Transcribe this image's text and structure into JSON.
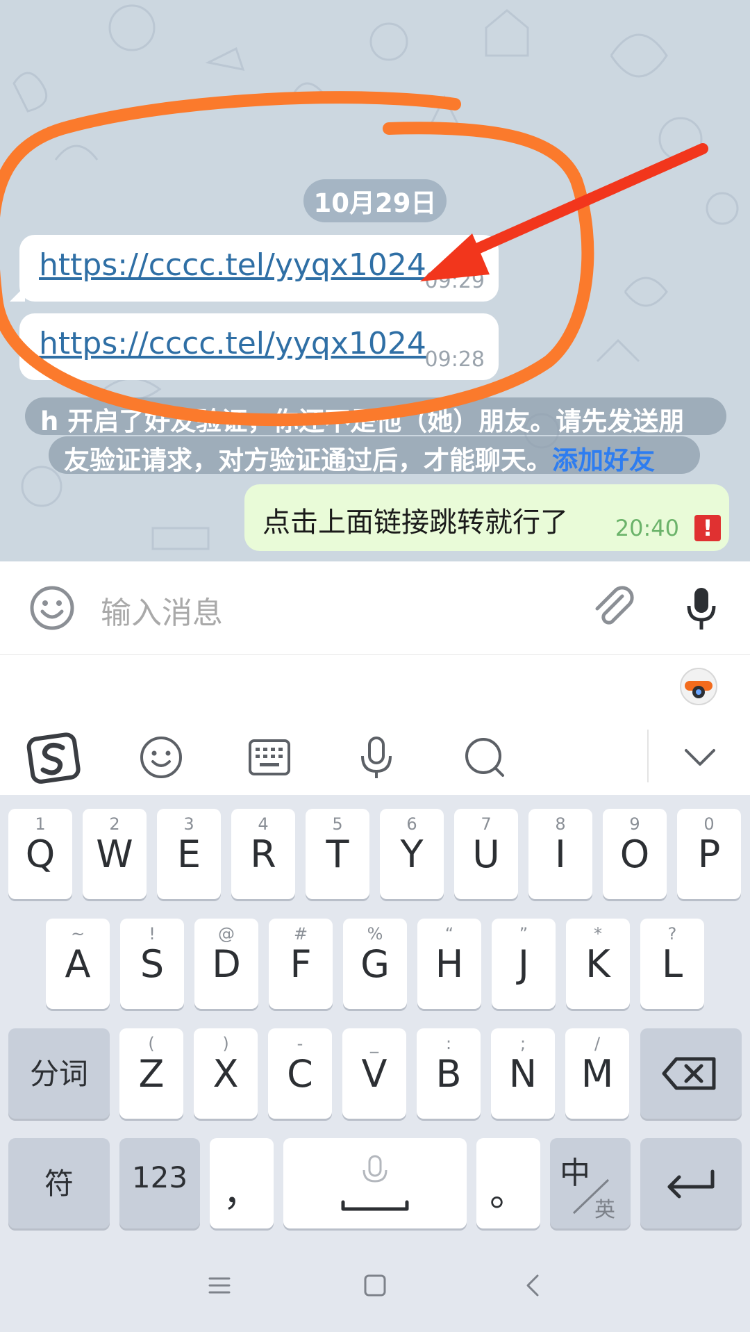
{
  "chat": {
    "date_label": "10月29日",
    "messages": [
      {
        "link": "https://cccc.tel/yyqx1024",
        "time": "09:29"
      },
      {
        "link": "https://cccc.tel/yyqx1024",
        "time": "09:28"
      }
    ],
    "system_notice": {
      "line1": "h 开启了好友验证，你还不是他（她）朋友。请先发送朋",
      "line2": "友验证请求，对方验证通过后，才能聊天。",
      "action_label": "添加好友"
    },
    "outgoing": {
      "text": "点击上面链接跳转就行了",
      "time": "20:40",
      "error_mark": "!"
    },
    "colors": {
      "annotation_circle": "#fb7a2c",
      "annotation_arrow": "#f2361c",
      "link": "#2f6fa5",
      "action": "#2e7df0"
    }
  },
  "input_bar": {
    "placeholder": "输入消息",
    "icons": [
      "smile-icon",
      "paperclip-icon",
      "microphone-icon"
    ]
  },
  "ime_toolbar": {
    "icons": [
      "sogou-logo-icon",
      "emoji-icon",
      "keyboard-icon",
      "voice-icon",
      "search-icon",
      "chevron-down-icon"
    ]
  },
  "keyboard": {
    "row1": [
      {
        "k": "Q",
        "s": "1"
      },
      {
        "k": "W",
        "s": "2"
      },
      {
        "k": "E",
        "s": "3"
      },
      {
        "k": "R",
        "s": "4"
      },
      {
        "k": "T",
        "s": "5"
      },
      {
        "k": "Y",
        "s": "6"
      },
      {
        "k": "U",
        "s": "7"
      },
      {
        "k": "I",
        "s": "8"
      },
      {
        "k": "O",
        "s": "9"
      },
      {
        "k": "P",
        "s": "0"
      }
    ],
    "row2": [
      {
        "k": "A",
        "s": "~"
      },
      {
        "k": "S",
        "s": "!"
      },
      {
        "k": "D",
        "s": "@"
      },
      {
        "k": "F",
        "s": "#"
      },
      {
        "k": "G",
        "s": "%"
      },
      {
        "k": "H",
        "s": "“"
      },
      {
        "k": "J",
        "s": "”"
      },
      {
        "k": "K",
        "s": "*"
      },
      {
        "k": "L",
        "s": "?"
      }
    ],
    "row3": [
      {
        "k": "Z",
        "s": "("
      },
      {
        "k": "X",
        "s": ")"
      },
      {
        "k": "C",
        "s": "-"
      },
      {
        "k": "V",
        "s": "_"
      },
      {
        "k": "B",
        "s": ":"
      },
      {
        "k": "N",
        "s": ";"
      },
      {
        "k": "M",
        "s": "/"
      }
    ],
    "segment_key": "分词",
    "symbol_key": "符",
    "number_key": "123",
    "comma_key": "，",
    "period_key": "。",
    "lang_key_main": "中",
    "lang_key_sub": "英"
  },
  "navbar": {
    "icons": [
      "menu-icon",
      "home-square-icon",
      "back-chevron-icon"
    ]
  }
}
